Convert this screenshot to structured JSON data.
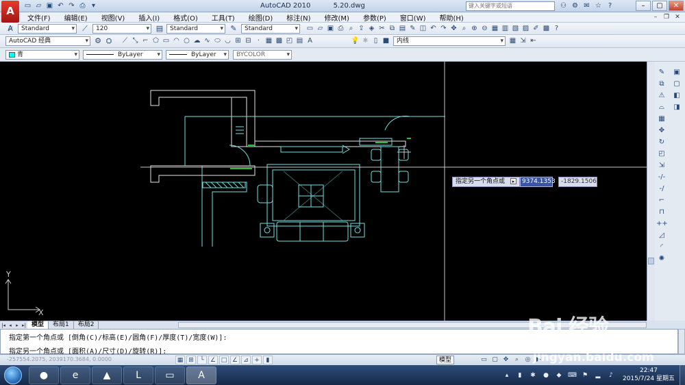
{
  "titlebar": {
    "app_name": "AutoCAD 2010",
    "file_name": "5.20.dwg",
    "help_placeholder": "键入关键字或短语",
    "logo_glyph": "A"
  },
  "menu": {
    "items": [
      "文件(F)",
      "编辑(E)",
      "视图(V)",
      "插入(I)",
      "格式(O)",
      "工具(T)",
      "绘图(D)",
      "标注(N)",
      "修改(M)",
      "参数(P)",
      "窗口(W)",
      "帮助(H)"
    ]
  },
  "toolbar1": {
    "text_style": "Standard",
    "dim_scale": "120",
    "dim_style": "Standard",
    "table_style": "Standard"
  },
  "toolbar2": {
    "workspace": "AutoCAD 经典",
    "linetype_layer": "内线"
  },
  "properties": {
    "color": "青",
    "linetype": "ByLayer",
    "lineweight": "ByLayer",
    "plot_style": "BYCOLOR"
  },
  "canvas": {
    "background": "#000000",
    "linework_color": "#6fe3e3",
    "accent_green": "#22c43a",
    "ucs_x": "X",
    "ucs_y": "Y"
  },
  "dynamic_input": {
    "prompt": "指定另一个角点或",
    "x_value": "9374.1353",
    "y_value": "-1829.1506"
  },
  "layout_tabs": [
    "模型",
    "布局1",
    "布局2"
  ],
  "command": {
    "line1": "指定第一个角点或 [倒角(C)/标高(E)/圆角(F)/厚度(T)/宽度(W)]:",
    "line2": "指定另一个角点或 [面积(A)/尺寸(D)/旋转(R)]:"
  },
  "status": {
    "coords": "-257554.2075, 2039170.3684, 0.0000",
    "space": "模型"
  },
  "taskbar": {
    "time": "22:47",
    "date": "2015/7/24 星期五"
  },
  "watermark": {
    "brand": "Bai   经验",
    "site": "jingyan.baidu.com"
  }
}
